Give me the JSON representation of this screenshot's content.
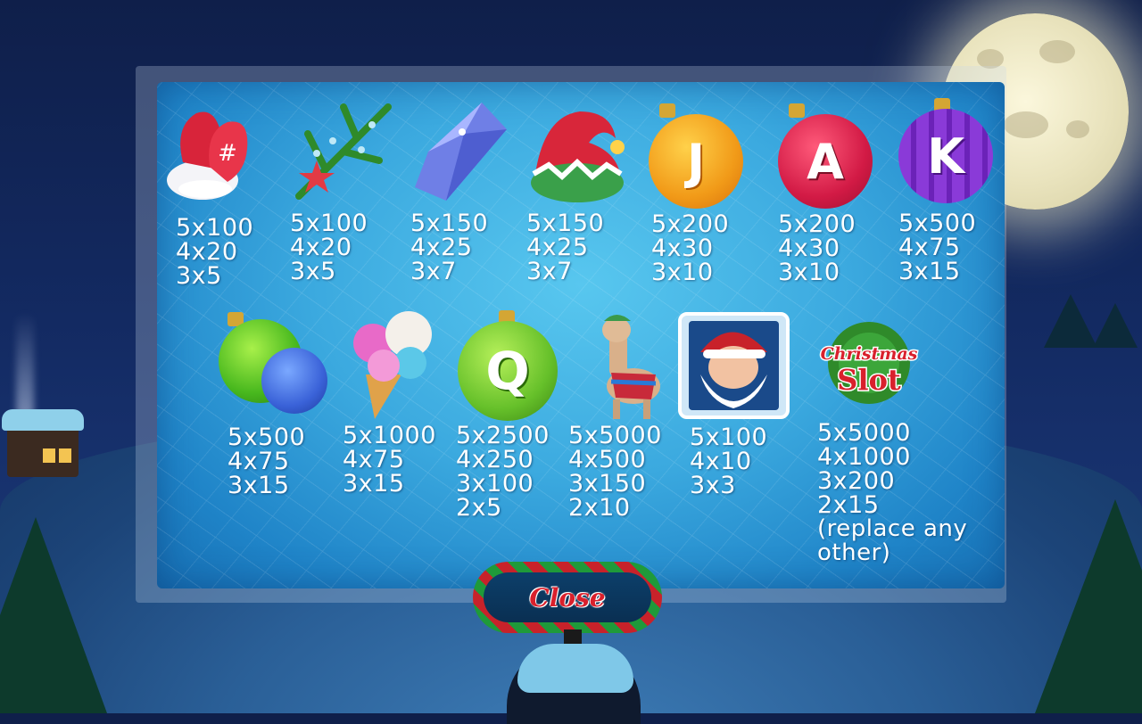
{
  "colors": {
    "panel": "#3ba9df",
    "text": "#ffffff",
    "close_text": "#d9202c",
    "stripe_red": "#c8222a",
    "stripe_green": "#1f9a3a"
  },
  "symbols": [
    {
      "name": "mittens",
      "icon": "mittens-icon",
      "pays": [
        "5x100",
        "4x20",
        "3x5"
      ]
    },
    {
      "name": "pine-branch",
      "icon": "pine-branch-icon",
      "pays": [
        "5x100",
        "4x20",
        "3x5"
      ]
    },
    {
      "name": "ice-crystal",
      "icon": "ice-crystal-icon",
      "pays": [
        "5x150",
        "4x25",
        "3x7"
      ]
    },
    {
      "name": "elf-hat",
      "icon": "elf-hat-icon",
      "pays": [
        "5x150",
        "4x25",
        "3x7"
      ]
    },
    {
      "name": "ornament-j",
      "icon": "ornament-j-icon",
      "letter": "J",
      "pays": [
        "5x200",
        "4x30",
        "3x10"
      ]
    },
    {
      "name": "ornament-a",
      "icon": "ornament-a-icon",
      "letter": "A",
      "pays": [
        "5x200",
        "4x30",
        "3x10"
      ]
    },
    {
      "name": "ornament-k",
      "icon": "ornament-k-icon",
      "letter": "K",
      "pays": [
        "5x500",
        "4x75",
        "3x15"
      ]
    },
    {
      "name": "baubles",
      "icon": "baubles-icon",
      "pays": [
        "5x500",
        "4x75",
        "3x15"
      ]
    },
    {
      "name": "ice-cream",
      "icon": "ice-cream-icon",
      "pays": [
        "5x1000",
        "4x75",
        "3x15"
      ]
    },
    {
      "name": "ornament-q",
      "icon": "ornament-q-icon",
      "letter": "Q",
      "pays": [
        "5x2500",
        "4x250",
        "3x100",
        "2x5"
      ]
    },
    {
      "name": "llama",
      "icon": "llama-icon",
      "pays": [
        "5x5000",
        "4x500",
        "3x150",
        "2x10"
      ]
    },
    {
      "name": "santa",
      "icon": "santa-icon",
      "pays": [
        "5x100",
        "4x10",
        "3x3"
      ]
    },
    {
      "name": "christmas-slot",
      "icon": "christmas-slot-logo",
      "logo_line1": "Christmas",
      "logo_line2": "Slot",
      "pays": [
        "5x5000",
        "4x1000",
        "3x200",
        "2x15"
      ],
      "note": "(replace any other)"
    }
  ],
  "close_label": "Close"
}
